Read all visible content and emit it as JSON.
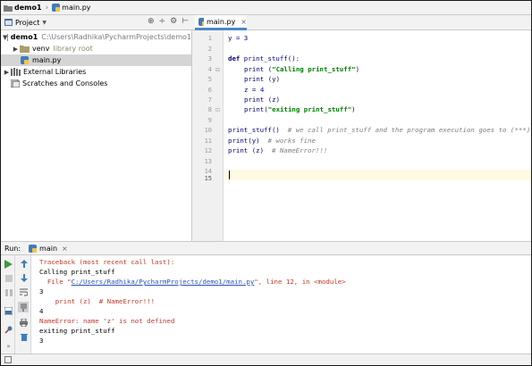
{
  "breadcrumb": {
    "project": "demo1",
    "file": "main.py"
  },
  "project_panel": {
    "title": "Project",
    "tree": [
      {
        "label": "demo1",
        "path": "C:\\Users\\Radhika\\PycharmProjects\\demo1"
      },
      {
        "label": "venv",
        "note": "library root"
      },
      {
        "label": "main.py"
      },
      {
        "label": "External Libraries"
      },
      {
        "label": "Scratches and Consoles"
      }
    ]
  },
  "editor": {
    "tab_label": "main.py",
    "line_numbers": [
      "1",
      "2",
      "3",
      "4",
      "5",
      "6",
      "7",
      "8",
      "9",
      "10",
      "11",
      "12",
      "13",
      "14",
      "15"
    ],
    "code": {
      "l1": "y = 3",
      "l3_kw": "def",
      "l3_rest": " print_stuff():",
      "l4_a": "print (",
      "l4_s": "\"Calling print_stuff\"",
      "l4_b": ")",
      "l5": "print (y)",
      "l6_a": "z = ",
      "l6_n": "4",
      "l7": "print (z)",
      "l8_a": "print(",
      "l8_s": "\"exiting print_stuff\"",
      "l8_b": ")",
      "l10_a": "print_stuff()  ",
      "l10_c": "# we call print_stuff and the program execution goes to (***)",
      "l11_a": "print(y)  ",
      "l11_c": "# works fine",
      "l12_a": "print (z)  ",
      "l12_c": "# NameError!!!"
    }
  },
  "run_panel": {
    "label": "Run:",
    "tab": "main",
    "console": {
      "c1": "Traceback (most recent call last):",
      "c2": "Calling print_stuff",
      "c3_a": "  File \"",
      "c3_link": "C:/Users/Radhika/PycharmProjects/demo1/main.py",
      "c3_b": "\", line 12, in <module>",
      "c4": "3",
      "c5": "    print (z)  # NameError!!!",
      "c6": "4",
      "c7": "NameError: name 'z' is not defined",
      "c8": "exiting print_stuff",
      "c9": "3"
    }
  },
  "colors": {
    "accent": "#4a88c7",
    "error": "#c0392b",
    "folder": "#7a7a7a",
    "python": "#3f7bbf"
  }
}
